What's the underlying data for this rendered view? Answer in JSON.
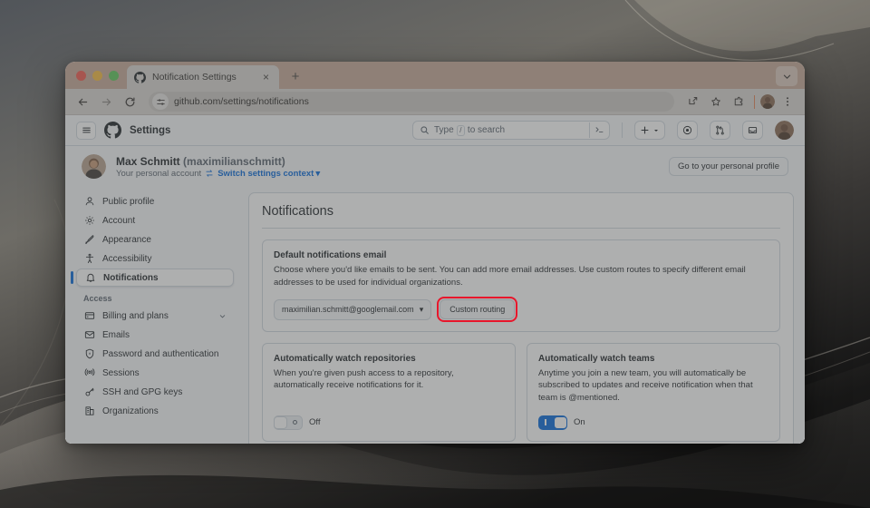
{
  "browser": {
    "tab": {
      "title": "Notification Settings",
      "favicon": "github-icon",
      "close": "×"
    },
    "new_tab": "+",
    "url": "github.com/settings/notifications",
    "toolbar_icons": [
      "back-arrow-icon",
      "forward-arrow-icon",
      "reload-icon",
      "site-settings-icon",
      "share-icon",
      "bookmark-star-icon",
      "extensions-icon",
      "profile-avatar-icon",
      "chrome-menu-icon"
    ],
    "tab_list_icon": "chevron-down-icon"
  },
  "github_header": {
    "menu_icon": "hamburger-icon",
    "logo": "github-mark-icon",
    "title": "Settings",
    "search_placeholder": "Type",
    "search_key": "/",
    "search_placeholder_suffix": "to search",
    "icons": [
      "command-palette-icon",
      "plus-icon",
      "chevron-down-icon",
      "issues-icon",
      "pull-requests-icon",
      "inbox-icon",
      "user-avatar"
    ]
  },
  "profile": {
    "name": "Max Schmitt",
    "login": "(maximilianschmitt)",
    "account_type": "Your personal account",
    "switch_label": "Switch settings context",
    "switch_icon": "switch-arrows-icon",
    "switch_caret": "▾",
    "personal_profile_button": "Go to your personal profile"
  },
  "sidebar": {
    "items": [
      {
        "label": "Public profile",
        "icon": "person-icon",
        "selected": false
      },
      {
        "label": "Account",
        "icon": "gear-icon",
        "selected": false
      },
      {
        "label": "Appearance",
        "icon": "paintbrush-icon",
        "selected": false
      },
      {
        "label": "Accessibility",
        "icon": "accessibility-icon",
        "selected": false
      },
      {
        "label": "Notifications",
        "icon": "bell-icon",
        "selected": true
      }
    ],
    "section_label": "Access",
    "access_items": [
      {
        "label": "Billing and plans",
        "icon": "credit-card-icon",
        "expandable": true
      },
      {
        "label": "Emails",
        "icon": "mail-icon",
        "expandable": false
      },
      {
        "label": "Password and authentication",
        "icon": "shield-lock-icon",
        "expandable": false
      },
      {
        "label": "Sessions",
        "icon": "broadcast-icon",
        "expandable": false
      },
      {
        "label": "SSH and GPG keys",
        "icon": "key-icon",
        "expandable": false
      },
      {
        "label": "Organizations",
        "icon": "organization-icon",
        "expandable": false
      }
    ]
  },
  "main": {
    "title": "Notifications",
    "default_email": {
      "heading": "Default notifications email",
      "description": "Choose where you'd like emails to be sent. You can add more email addresses. Use custom routes to specify different email addresses to be used for individual organizations.",
      "selected_email": "maximilian.schmitt@googlemail.com",
      "select_caret": "▾",
      "custom_routing_button": "Custom routing"
    },
    "watch_repositories": {
      "heading": "Automatically watch repositories",
      "description": "When you're given push access to a repository, automatically receive notifications for it.",
      "toggle_state": "Off",
      "toggle_on": false
    },
    "watch_teams": {
      "heading": "Automatically watch teams",
      "description": "Anytime you join a new team, you will automatically be subscribed to updates and receive notification when that team is @mentioned.",
      "toggle_state": "On",
      "toggle_on": true
    }
  },
  "annotation": {
    "target": "Custom routing",
    "color": "#e8162b"
  },
  "colors": {
    "accent": "#0969da",
    "annotation": "#e8162b",
    "gh_border": "#d1d9e0",
    "gh_surface": "#f6f8fa"
  }
}
